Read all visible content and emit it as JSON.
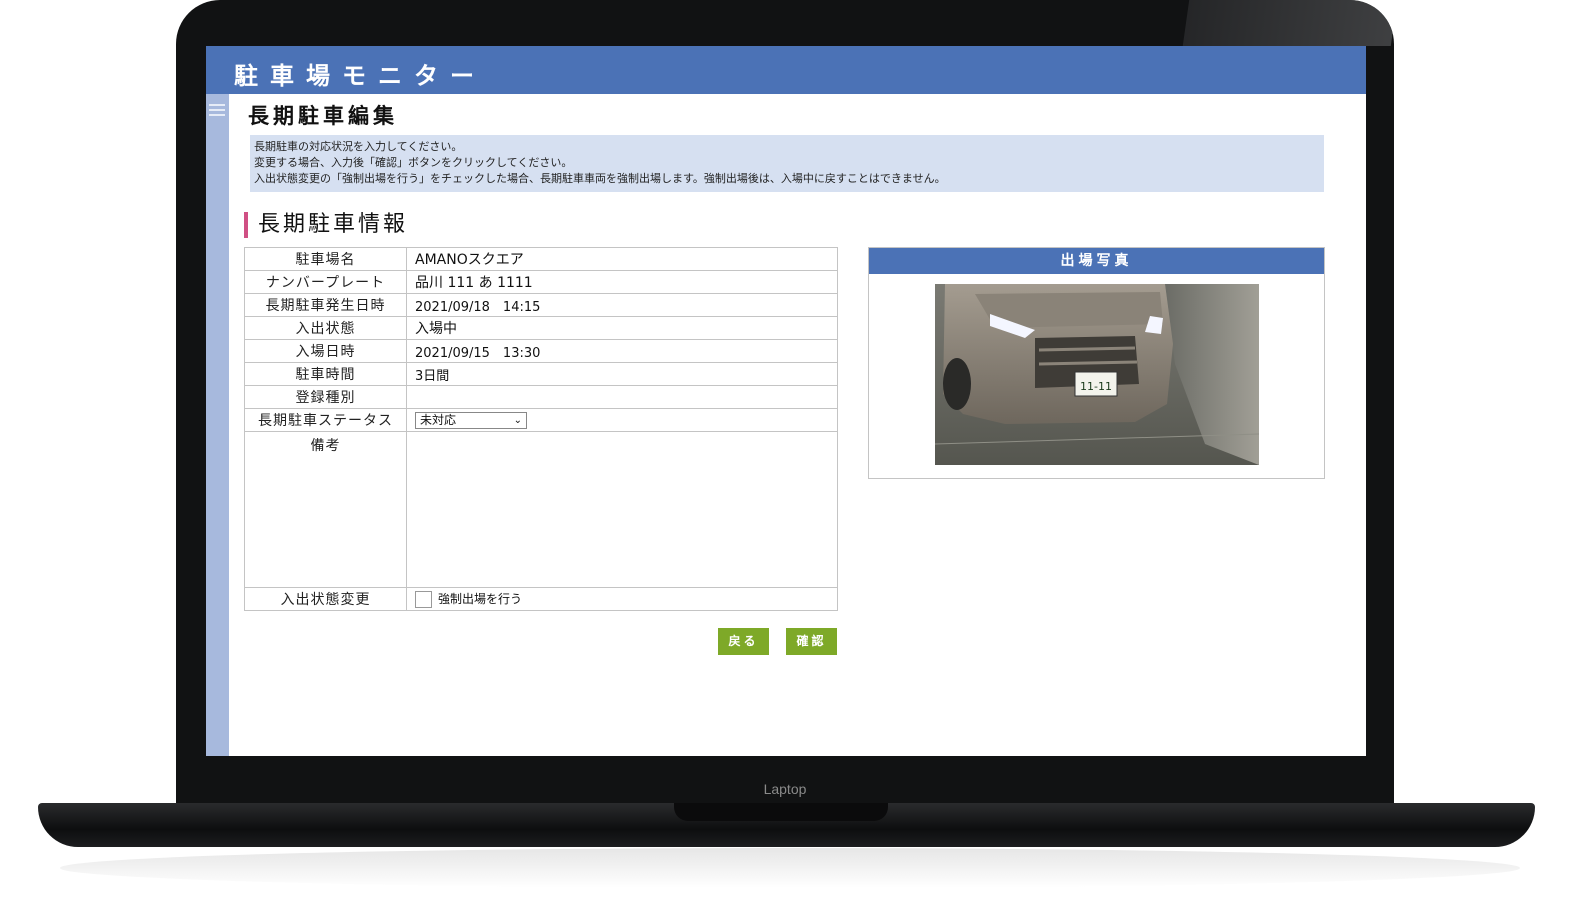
{
  "app": {
    "title": "駐車場モニター"
  },
  "page": {
    "title": "長期駐車編集"
  },
  "info": {
    "lines": [
      "長期駐車の対応状況を入力してください。",
      "変更する場合、入力後「確認」ボタンをクリックしてください。",
      "入出状態変更の「強制出場を行う」をチェックした場合、長期駐車車両を強制出場します。強制出場後は、入場中に戻すことはできません。"
    ]
  },
  "section": {
    "title": "長期駐車情報"
  },
  "form": {
    "rows": [
      {
        "label": "駐車場名",
        "value": "AMANOスクエア"
      },
      {
        "label": "ナンバープレート",
        "value": "品川 111 あ 1111"
      },
      {
        "label": "長期駐車発生日時",
        "value": "2021/09/18　14:15"
      },
      {
        "label": "入出状態",
        "value": "入場中"
      },
      {
        "label": "入場日時",
        "value": "2021/09/15　13:30"
      },
      {
        "label": "駐車時間",
        "value": "3日間"
      },
      {
        "label": "登録種別",
        "value": ""
      }
    ],
    "status_label": "長期駐車ステータス",
    "status_value": "未対応",
    "remarks_label": "備考",
    "state_change_label": "入出状態変更",
    "force_exit_label": "強制出場を行う"
  },
  "buttons": {
    "back": "戻る",
    "confirm": "確認"
  },
  "photo": {
    "title": "出場写真",
    "plate_text": "11-11"
  },
  "device": {
    "label": "Laptop"
  },
  "colors": {
    "header": "#4b72b6",
    "sidebar": "#a7b9dd",
    "info_bg": "#d6e0f1",
    "accent": "#d05084",
    "button": "#7ea928"
  }
}
